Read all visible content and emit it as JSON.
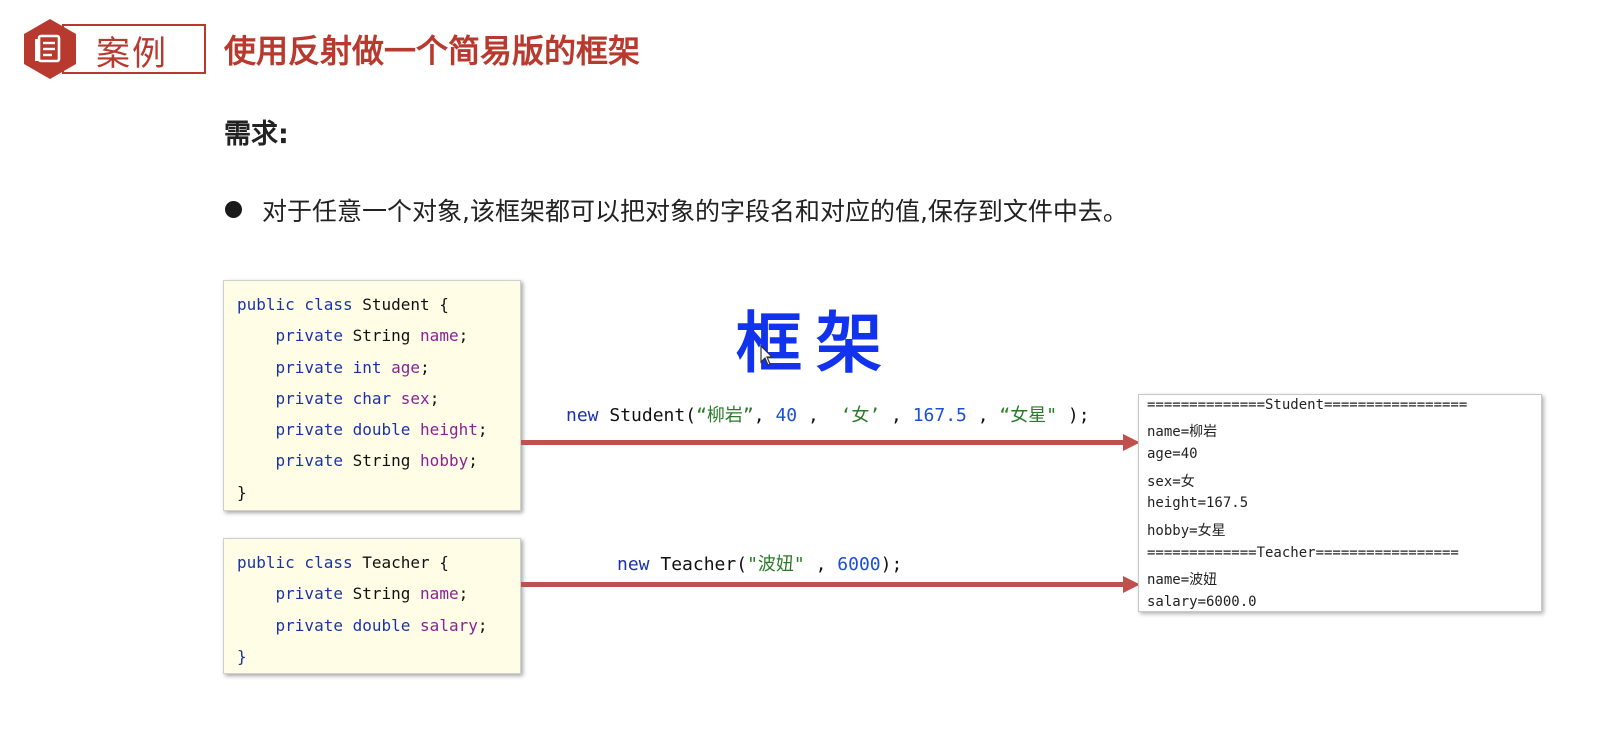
{
  "badge": {
    "label": "案例"
  },
  "title": "使用反射做一个简易版的框架",
  "requirement_heading": "需求:",
  "bullet": "对于任意一个对象,该框架都可以把对象的字段名和对应的值,保存到文件中去。",
  "handwriting": "框架",
  "student_class": {
    "l1_kw": "public class",
    "l1_rest": " Student {",
    "fields": [
      {
        "mod": "private",
        "type": "String",
        "name": "name"
      },
      {
        "mod": "private",
        "type": "int",
        "name": "age"
      },
      {
        "mod": "private",
        "type": "char",
        "name": "sex"
      },
      {
        "mod": "private",
        "type": "double",
        "name": "height"
      },
      {
        "mod": "private",
        "type": "String",
        "name": "hobby"
      }
    ],
    "close": "}"
  },
  "teacher_class": {
    "l1_kw": "public class",
    "l1_rest": " Teacher {",
    "fields": [
      {
        "mod": "private",
        "type": "String",
        "name": "name"
      },
      {
        "mod": "private",
        "type": "double",
        "name": "salary"
      }
    ],
    "close": "}"
  },
  "student_call": {
    "new": "new",
    "cls": " Student(",
    "a1": "“柳岩”",
    "s1": ", ",
    "a2": "40",
    "s2": " ,  ",
    "a3": "‘女’",
    "s3": " , ",
    "a4": "167.5",
    "s4": " , ",
    "a5": "“女星\"",
    "end": " );"
  },
  "teacher_call": {
    "new": "new",
    "cls": " Teacher(",
    "a1": "\"波妞\"",
    "s1": " , ",
    "a2": "6000",
    "end": ");"
  },
  "output_lines": [
    "==============Student=================",
    "name=柳岩",
    "age=40",
    "sex=女",
    "height=167.5",
    "hobby=女星",
    "=============Teacher=================",
    "name=波妞",
    "salary=6000.0"
  ],
  "colors": {
    "accent": "#b83a2e",
    "arrow": "#c0504d",
    "code_bg": "#fffde5",
    "handwriting": "#1133ee"
  }
}
